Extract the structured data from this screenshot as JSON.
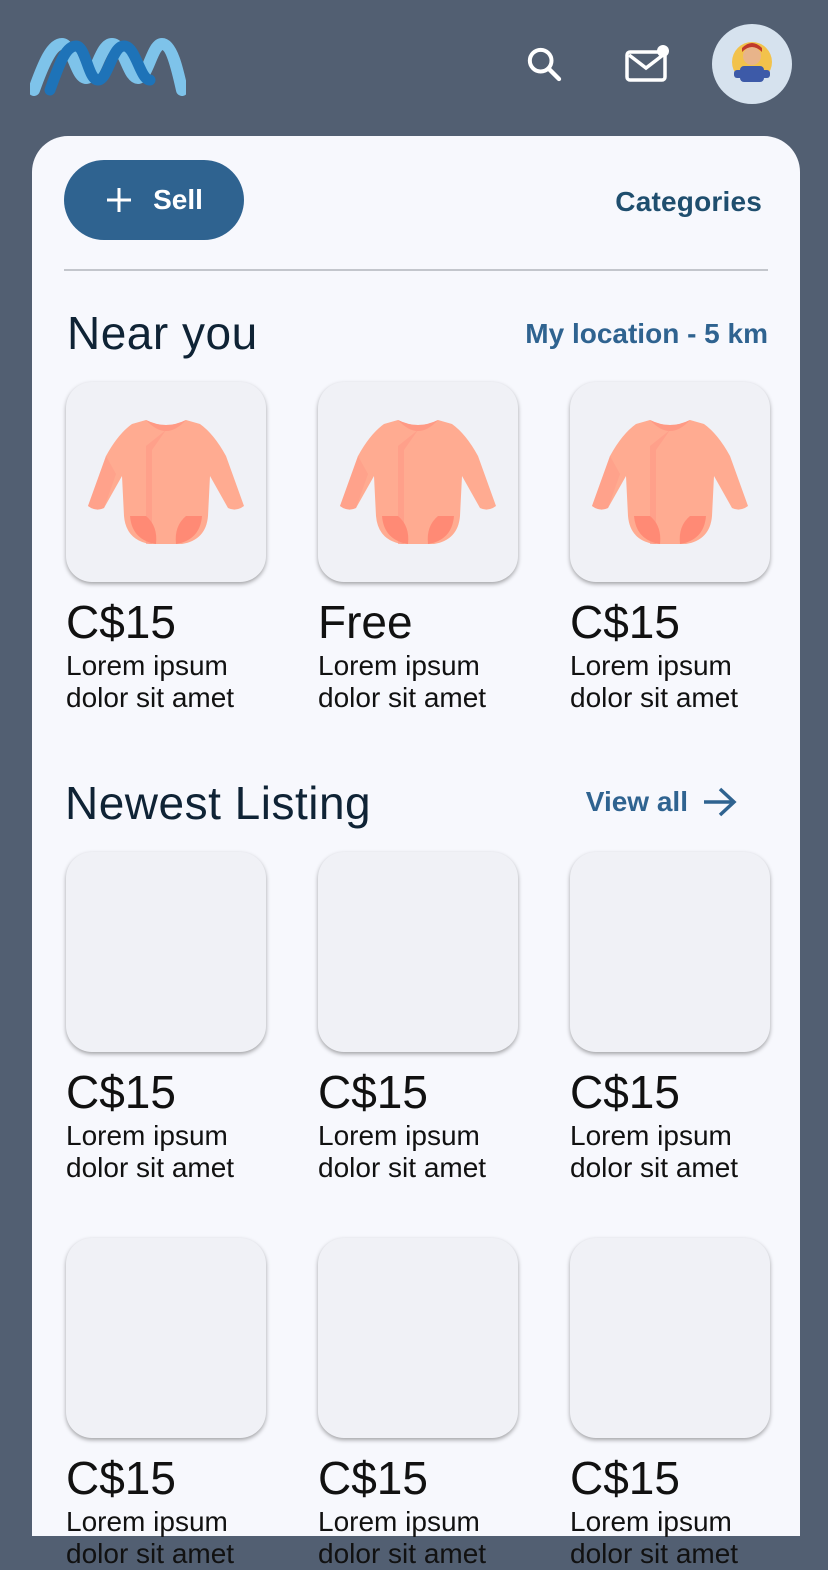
{
  "header": {
    "logo": "logo-icon",
    "search_icon": "search-icon",
    "mail_icon": "mail-icon",
    "avatar": "avatar"
  },
  "toolbar": {
    "sell_label": "Sell",
    "categories_label": "Categories"
  },
  "near_you": {
    "title": "Near you",
    "location_label": "My location - 5 km",
    "items": [
      {
        "price": "C$15",
        "desc": "Lorem ipsum dolor sit amet"
      },
      {
        "price": "Free",
        "desc": "Lorem ipsum dolor sit amet"
      },
      {
        "price": "C$15",
        "desc": "Lorem ipsum dolor sit amet"
      }
    ]
  },
  "newest": {
    "title": "Newest Listing",
    "view_all_label": "View all",
    "items": [
      {
        "price": "C$15",
        "desc": "Lorem ipsum dolor sit amet"
      },
      {
        "price": "C$15",
        "desc": "Lorem ipsum dolor sit amet"
      },
      {
        "price": "C$15",
        "desc": "Lorem ipsum dolor sit amet"
      },
      {
        "price": "C$15",
        "desc": "Lorem ipsum dolor sit amet"
      },
      {
        "price": "C$15",
        "desc": "Lorem ipsum dolor sit amet"
      },
      {
        "price": "C$15",
        "desc": "Lorem ipsum dolor sit amet"
      }
    ]
  },
  "colors": {
    "background": "#525f72",
    "panel": "#f7f8fd",
    "accent": "#2f6390",
    "product": "#ffab91"
  }
}
